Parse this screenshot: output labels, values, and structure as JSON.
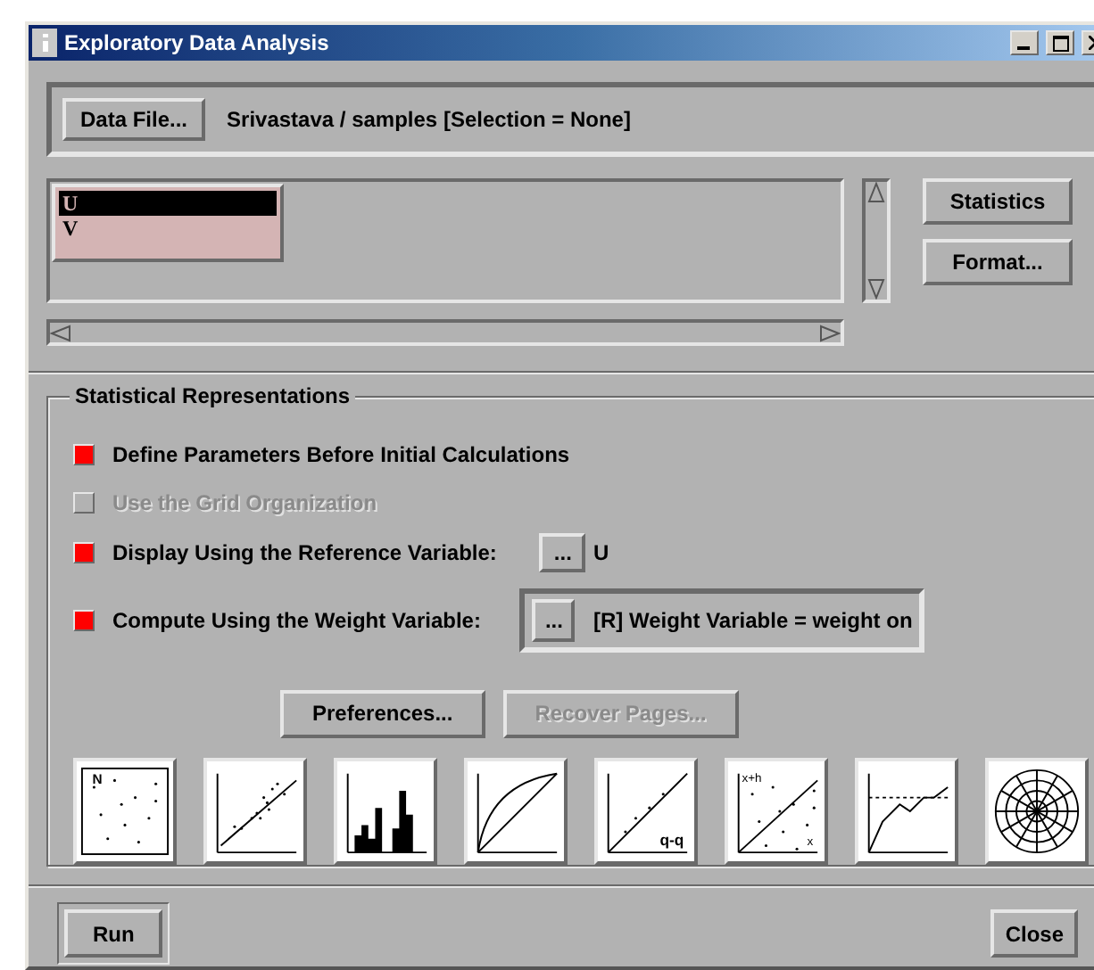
{
  "window": {
    "title": "Exploratory Data Analysis"
  },
  "data_file": {
    "button": "Data File...",
    "description": "Srivastava / samples [Selection = None]"
  },
  "variables": [
    {
      "label": "U",
      "selected": true
    },
    {
      "label": "V",
      "selected": false
    }
  ],
  "side_buttons": [
    "Statistics",
    "Format..."
  ],
  "options": {
    "title": "Statistical Representations",
    "items": [
      {
        "kind": "plain",
        "label": "Define Parameters Before Initial Calculations",
        "checked": true,
        "disabled": false
      },
      {
        "kind": "plain",
        "label": "Use the Grid Organization",
        "checked": false,
        "disabled": true
      },
      {
        "kind": "picker",
        "label": "Display Using the Reference Variable:",
        "checked": true,
        "disabled": false,
        "button": "...",
        "value": "U"
      },
      {
        "kind": "boxed_picker",
        "label": "Compute Using the Weight Variable:",
        "checked": true,
        "disabled": false,
        "button": "...",
        "value": "[R] Weight Variable = weight on"
      }
    ]
  },
  "actions": [
    {
      "label": "Preferences...",
      "disabled": false
    },
    {
      "label": "Recover Pages...",
      "disabled": true
    }
  ],
  "plot_buttons": [
    {
      "kind": "uniform",
      "label": "N"
    },
    {
      "kind": "scatter"
    },
    {
      "kind": "histogram"
    },
    {
      "kind": "curve"
    },
    {
      "kind": "qq",
      "label": "q-q"
    },
    {
      "kind": "lag",
      "label": "x+h",
      "xlabel": "x"
    },
    {
      "kind": "variogram"
    },
    {
      "kind": "polar"
    }
  ],
  "footer": {
    "run": "Run",
    "close": "Close"
  }
}
